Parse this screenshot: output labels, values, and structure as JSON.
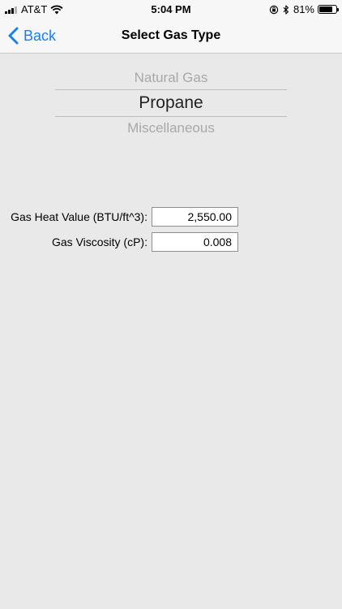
{
  "status_bar": {
    "carrier": "AT&T",
    "time": "5:04 PM",
    "battery_percent": "81%",
    "battery_level": 0.81,
    "icons": [
      "signal-icon",
      "wifi-icon",
      "orientation-lock-icon",
      "bluetooth-icon",
      "battery-icon"
    ]
  },
  "nav": {
    "back_label": "Back",
    "title": "Select Gas Type"
  },
  "picker": {
    "options": [
      "Natural Gas",
      "Propane",
      "Miscellaneous"
    ],
    "selected": "Propane"
  },
  "form": {
    "heat_value": {
      "label": "Gas Heat Value (BTU/ft^3):",
      "value": "2,550.00"
    },
    "viscosity": {
      "label": "Gas Viscosity (cP):",
      "value": "0.008"
    }
  },
  "colors": {
    "accent": "#1a7ff5",
    "background": "#e9e9e9",
    "bar_background": "#f7f7f7"
  }
}
